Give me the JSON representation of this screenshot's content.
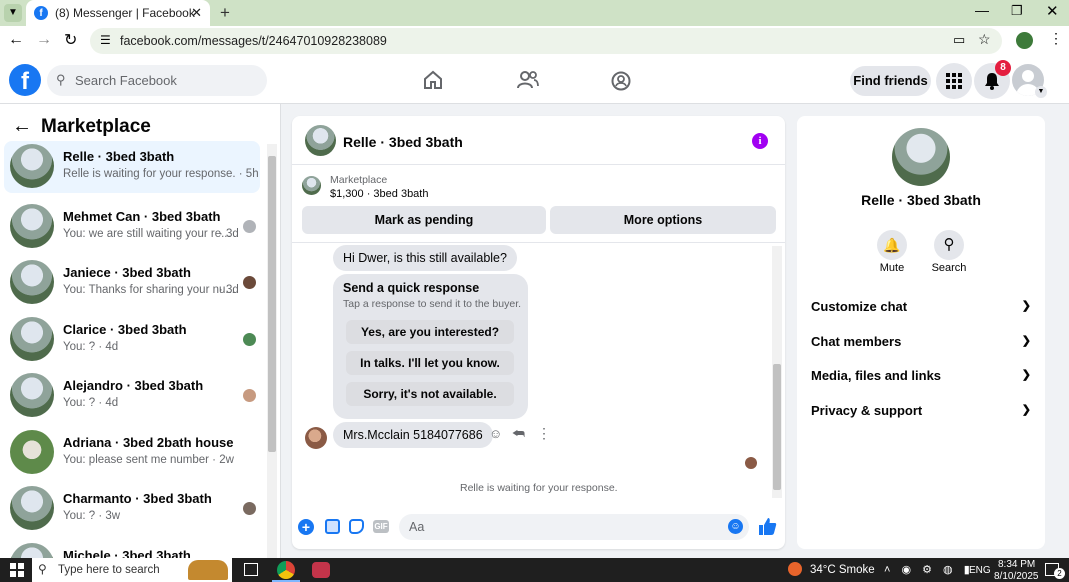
{
  "browser": {
    "tab_title": "(8) Messenger | Facebook",
    "url": "facebook.com/messages/t/24647010928238089"
  },
  "facebook": {
    "search_placeholder": "Search Facebook",
    "find_friends": "Find friends",
    "notif_count": "8"
  },
  "sidebar": {
    "title": "Marketplace",
    "conversations": [
      {
        "name": "Relle · 3bed 3bath",
        "preview": "Relle is waiting for your response. · 5h",
        "time": ""
      },
      {
        "name": "Mehmet Can · 3bed 3bath",
        "preview": "You: we are still waiting your re...",
        "time": "· 3d"
      },
      {
        "name": "Janiece · 3bed 3bath",
        "preview": "You: Thanks for sharing your nu...",
        "time": "· 3d"
      },
      {
        "name": "Clarice · 3bed 3bath",
        "preview": "You: ? · 4d",
        "time": ""
      },
      {
        "name": "Alejandro · 3bed 3bath",
        "preview": "You: ? · 4d",
        "time": ""
      },
      {
        "name": "Adriana · 3bed 2bath house",
        "preview": "You: please sent me number · 2w",
        "time": ""
      },
      {
        "name": "Charmanto · 3bed 3bath",
        "preview": "You: ? · 3w",
        "time": ""
      },
      {
        "name": "Michele · 3bed 3bath",
        "preview": "",
        "time": ""
      }
    ]
  },
  "chat": {
    "title": "Relle · 3bed 3bath",
    "listing_label": "Marketplace",
    "listing_detail": "$1,300 · 3bed 3bath",
    "mark_pending": "Mark as pending",
    "more_options": "More options",
    "msg1": "Hi Dwer, is this still available?",
    "quick_title": "Send a quick response",
    "quick_sub": "Tap a response to send it to the buyer.",
    "quick_options": [
      "Yes, are you interested?",
      "In talks. I'll let you know.",
      "Sorry, it's not available."
    ],
    "msg2": "Mrs.Mcclain 5184077686",
    "status": "Relle is waiting for your response.",
    "composer_placeholder": "Aa"
  },
  "details": {
    "name": "Relle · 3bed 3bath",
    "mute": "Mute",
    "search": "Search",
    "sections": [
      "Customize chat",
      "Chat members",
      "Media, files and links",
      "Privacy & support"
    ]
  },
  "taskbar": {
    "search_placeholder": "Type here to search",
    "weather": "34°C  Smoke",
    "lang": "ENG",
    "time": "8:34 PM",
    "date": "8/10/2025",
    "notif": "2"
  },
  "colors": {
    "accent": "#1877f2",
    "info": "#a100f2"
  }
}
